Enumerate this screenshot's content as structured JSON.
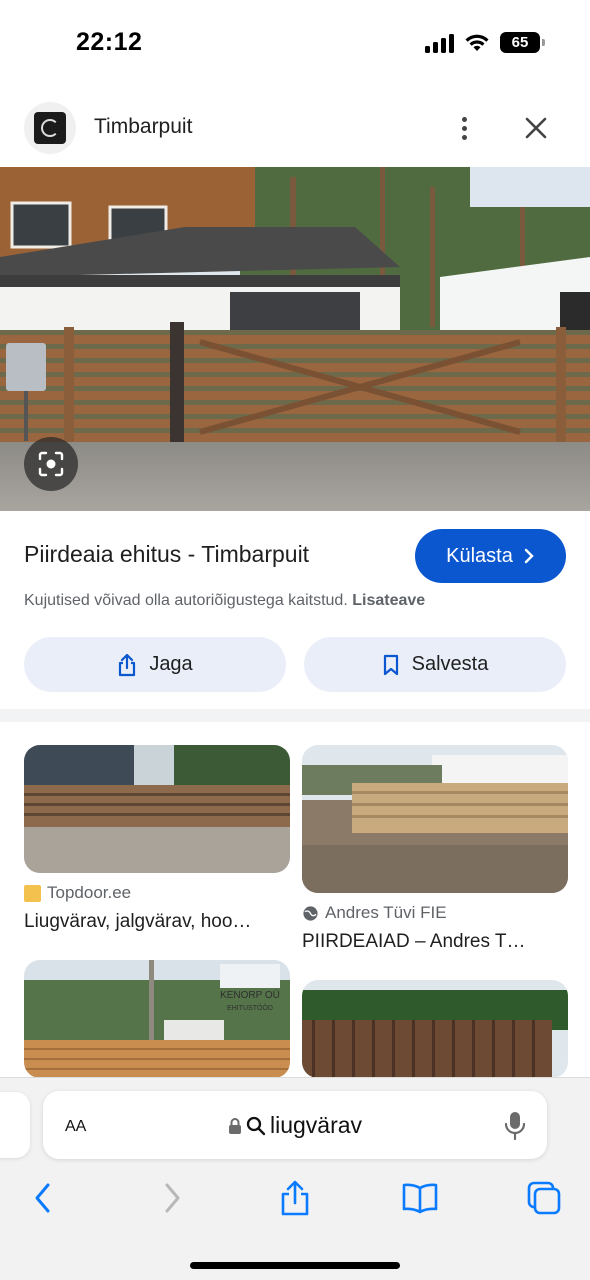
{
  "status_bar": {
    "time": "22:12",
    "battery": "65"
  },
  "header": {
    "site_name": "Timbarpuit"
  },
  "result": {
    "title": "Piirdeaia ehitus - Timbarpuit",
    "visit_label": "Külasta",
    "copyright_text": "Kujutised võivad olla autoriõigustega kaitstud.",
    "learn_more": "Lisateave",
    "share_label": "Jaga",
    "save_label": "Salvesta"
  },
  "related": [
    {
      "source": "Topdoor.ee",
      "title": "Liugvärav, jalgvärav, hoo…"
    },
    {
      "source": "Andres Tüvi FIE",
      "title": "PIIRDEAIAD – Andres T…"
    },
    {
      "source": "",
      "title": "",
      "watermark": "KENORP OÜ EHITUSTÖÖD"
    },
    {
      "source": "",
      "title": ""
    }
  ],
  "browser": {
    "aa_label": "AA",
    "query": "liugvärav"
  },
  "icons": {
    "more": "more-vert-icon",
    "close": "close-icon",
    "lens": "lens-search-icon",
    "share": "share-icon",
    "bookmark": "bookmark-icon",
    "lock": "lock-icon",
    "search": "search-icon",
    "mic": "mic-icon",
    "back": "chevron-left-icon",
    "forward": "chevron-right-icon",
    "safari_share": "share-icon",
    "book": "book-icon",
    "tabs": "tabs-icon"
  },
  "colors": {
    "accent": "#0b57d0",
    "chip_bg": "#e9eef9",
    "toolbar_bg": "#f2f2f2"
  }
}
